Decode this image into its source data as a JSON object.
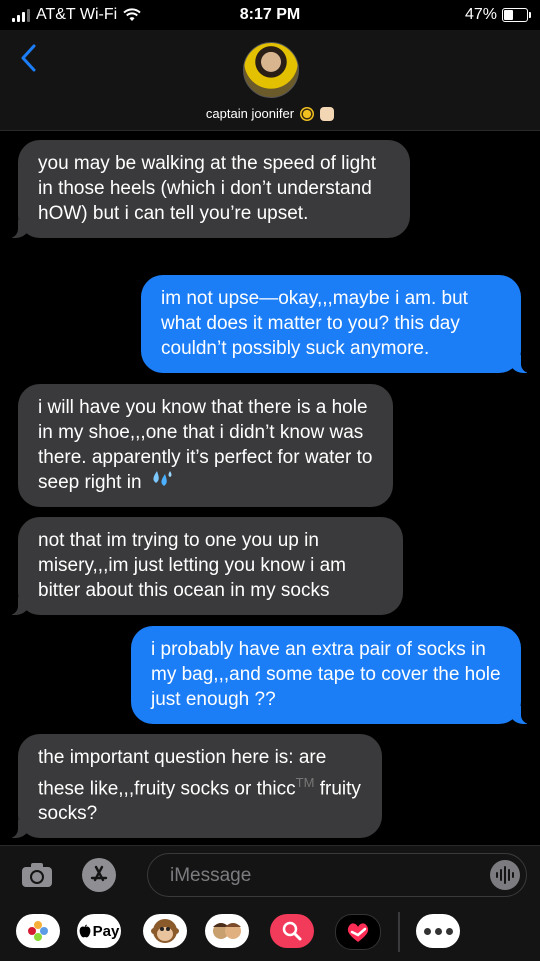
{
  "status_bar": {
    "carrier": "AT&T Wi-Fi",
    "time": "8:17 PM",
    "battery": "47%",
    "battery_level": 0.47
  },
  "header": {
    "contact_name": "captain joonifer"
  },
  "messages": [
    {
      "direction": "incoming",
      "text": "you may be walking at the speed of light in those heels (which i don’t understand hOW) but i can tell you’re upset."
    },
    {
      "direction": "outgoing",
      "text": "im not upse—okay,,,maybe i am. but what does it matter to you? this day couldn’t possibly suck anymore."
    },
    {
      "direction": "incoming",
      "text": "i will have you know that there is a hole in my shoe,,,one that i didn’t know was there. apparently it’s perfect for water to seep right in",
      "emoji": "sweat-droplets-icon"
    },
    {
      "direction": "incoming",
      "text": "not that im trying to one you up in misery,,,im just letting you know i am bitter about this ocean in my socks"
    },
    {
      "direction": "outgoing",
      "text": "i probably have an extra pair of socks in my bag,,,and some tape to cover the hole just enough  ??"
    },
    {
      "direction": "incoming",
      "text": "the important question here is: are these like,,,fruity socks or thicc",
      "suffix_mark": "TM",
      "text_end": "fruity socks?"
    }
  ],
  "composer": {
    "placeholder": "iMessage"
  },
  "app_drawer": {
    "apple_pay_label": "Pay"
  },
  "colors": {
    "incoming_bubble": "#3a3a3c",
    "outgoing_bubble": "#1c7ef7",
    "back_chevron": "#1c7ef7"
  }
}
